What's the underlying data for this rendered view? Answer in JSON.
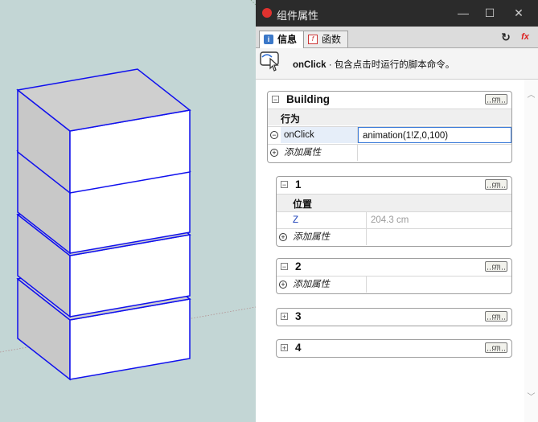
{
  "window": {
    "title": "组件属性",
    "minimize": "—",
    "maximize": "☐",
    "close": "✕"
  },
  "tabs": [
    {
      "label": "信息",
      "active": true
    },
    {
      "label": "函数",
      "active": false
    }
  ],
  "toolbar": {
    "refresh_icon": "↻",
    "formula_icon": "fx"
  },
  "help": {
    "name": "onClick",
    "description": " · 包含点击时运行的脚本命令。"
  },
  "unit_label": "cm",
  "groups": {
    "building": {
      "name": "Building",
      "toggle": "−",
      "section": "行为",
      "attr_name": "onClick",
      "attr_value": "animation(1!Z,0,100)",
      "add_label": "添加属性"
    },
    "g1": {
      "name": "1",
      "toggle": "−",
      "section": "位置",
      "attr_name": "Z",
      "attr_value": "204.3 cm",
      "add_label": "添加属性"
    },
    "g2": {
      "name": "2",
      "toggle": "−",
      "add_label": "添加属性"
    },
    "g3": {
      "name": "3",
      "toggle": "+"
    },
    "g4": {
      "name": "4",
      "toggle": "+"
    }
  },
  "colors": {
    "viewport_bg": "#c3d6d5",
    "edge_blue": "#1010ee",
    "face_gray": "#c8c8c8",
    "face_white": "#ffffff",
    "titlebar": "#2b2b2b"
  }
}
